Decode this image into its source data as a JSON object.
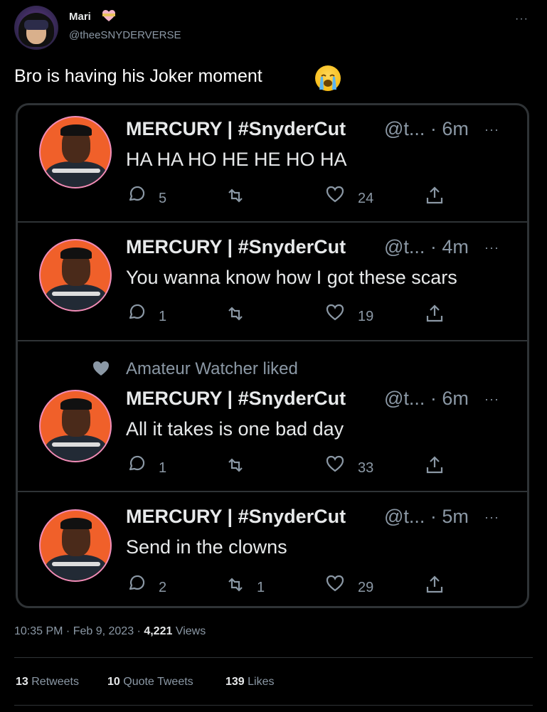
{
  "author": {
    "name": "Mari",
    "handle": "@theeSNYDERVERSE",
    "more": "···"
  },
  "tweet": {
    "text": "Bro is having his Joker moment"
  },
  "embedded_posts": [
    {
      "name": "MERCURY | #SnyderCut",
      "handle_time": "@t... · 6m",
      "body": "HA HA HO HE HE HO HA",
      "replies": "5",
      "retweets": "",
      "likes": "24"
    },
    {
      "name": "MERCURY | #SnyderCut",
      "handle_time": "@t... · 4m",
      "body": "You wanna know how I got these scars",
      "replies": "1",
      "retweets": "",
      "likes": "19"
    },
    {
      "liked_by": "Amateur Watcher liked",
      "name": "MERCURY | #SnyderCut",
      "handle_time": "@t... · 6m",
      "body": "All it takes is one bad day",
      "replies": "1",
      "retweets": "",
      "likes": "33"
    },
    {
      "name": "MERCURY | #SnyderCut",
      "handle_time": "@t... · 5m",
      "body": "Send in the clowns",
      "replies": "2",
      "retweets": "1",
      "likes": "29"
    }
  ],
  "meta": {
    "time": "10:35 PM · Feb 9, 2023 · ",
    "views_count": "4,221",
    "views_label": " Views"
  },
  "stats": {
    "retweets_count": "13",
    "retweets_label": " Retweets",
    "quotes_count": "10",
    "quotes_label": " Quote Tweets",
    "likes_count": "139",
    "likes_label": " Likes"
  },
  "colors": {
    "background": "#000000",
    "text": "#e7e9ea",
    "muted": "#8b98a5",
    "border": "#2f3336"
  }
}
